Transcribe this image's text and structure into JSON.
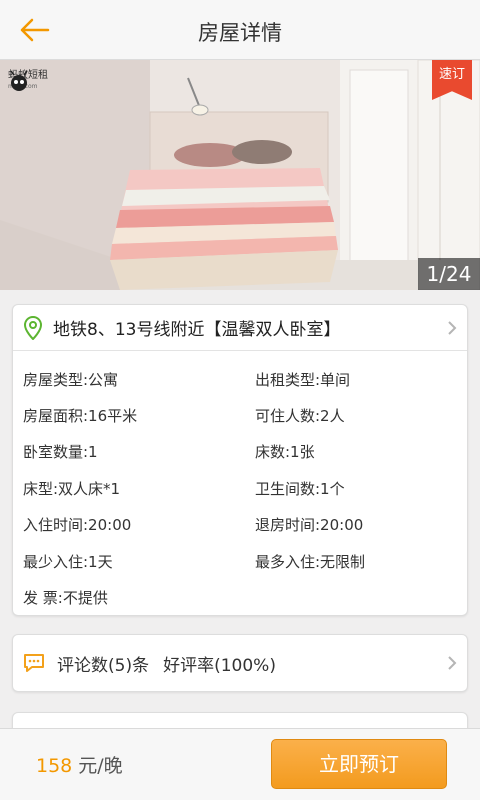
{
  "header": {
    "title": "房屋详情"
  },
  "gallery": {
    "logo_text": "蚂蚁短租",
    "logo_sub": "mayi.com",
    "badge": "速订",
    "counter": "1/24"
  },
  "listing": {
    "title": "地铁8、13号线附近【温馨双人卧室】",
    "details": [
      {
        "left": "房屋类型:公寓",
        "right": "出租类型:单间"
      },
      {
        "left": "房屋面积:16平米",
        "right": "可住人数:2人"
      },
      {
        "left": "卧室数量:1",
        "right": "床数:1张"
      },
      {
        "left": "床型:双人床*1",
        "right": "卫生间数:1个"
      },
      {
        "left": "入住时间:20:00",
        "right": "退房时间:20:00"
      },
      {
        "left": "最少入住:1天",
        "right": "最多入住:无限制"
      },
      {
        "left": "发 票:不提供",
        "right": ""
      }
    ]
  },
  "reviews": {
    "count_text": "评论数(5)条",
    "rate_text": "好评率(100%)"
  },
  "footer": {
    "price": "158",
    "unit": "元/晚",
    "book_label": "立即预订"
  },
  "colors": {
    "accent": "#f39800",
    "badge": "#e94a2f",
    "pin": "#5cb531",
    "comment": "#f3a11b"
  }
}
